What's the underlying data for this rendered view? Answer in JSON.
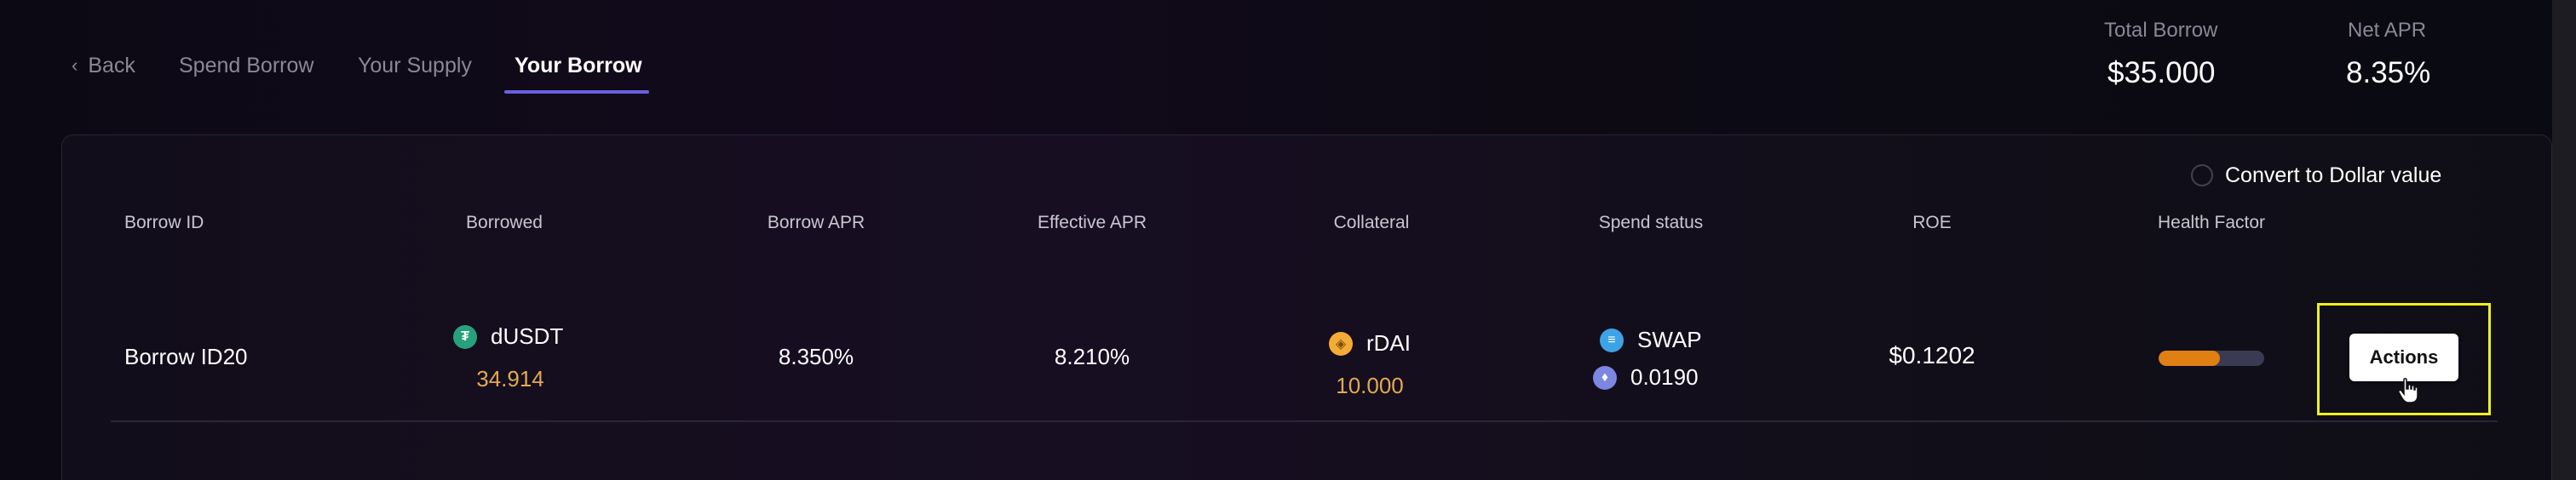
{
  "nav": {
    "back_label": "Back",
    "tabs": [
      {
        "label": "Spend Borrow"
      },
      {
        "label": "Your Supply"
      },
      {
        "label": "Your Borrow",
        "active": true
      }
    ]
  },
  "summary": {
    "total_borrow_label": "Total Borrow",
    "total_borrow_value": "$35.000",
    "net_apr_label": "Net APR",
    "net_apr_value": "8.35%"
  },
  "panel": {
    "convert_label": "Convert to Dollar value",
    "convert_checked": false,
    "columns": [
      "Borrow ID",
      "Borrowed",
      "Borrow APR",
      "Effective APR",
      "Collateral",
      "Spend status",
      "ROE",
      "Health Factor"
    ],
    "rows": [
      {
        "borrow_id": "Borrow ID20",
        "borrowed_asset": "dUSDT",
        "borrowed_amount": "34.914",
        "borrow_apr": "8.350%",
        "effective_apr": "8.210%",
        "collateral_asset": "rDAI",
        "collateral_amount": "10.000",
        "spend_status": "SWAP",
        "spend_amount": "0.0190",
        "roe": "$0.1202",
        "health_factor_fraction": 0.58,
        "actions_label": "Actions"
      }
    ]
  },
  "icons": {
    "borrowed_asset": "tether-token-icon",
    "collateral_asset": "dai-token-icon",
    "spend_status": "swap-icon",
    "spend_amount": "ethereum-icon"
  },
  "colors": {
    "accent": "#6b5fe0",
    "amount_gold": "#e3a94f",
    "health_fill": "#e07f12",
    "highlight": "#f0f01a"
  }
}
